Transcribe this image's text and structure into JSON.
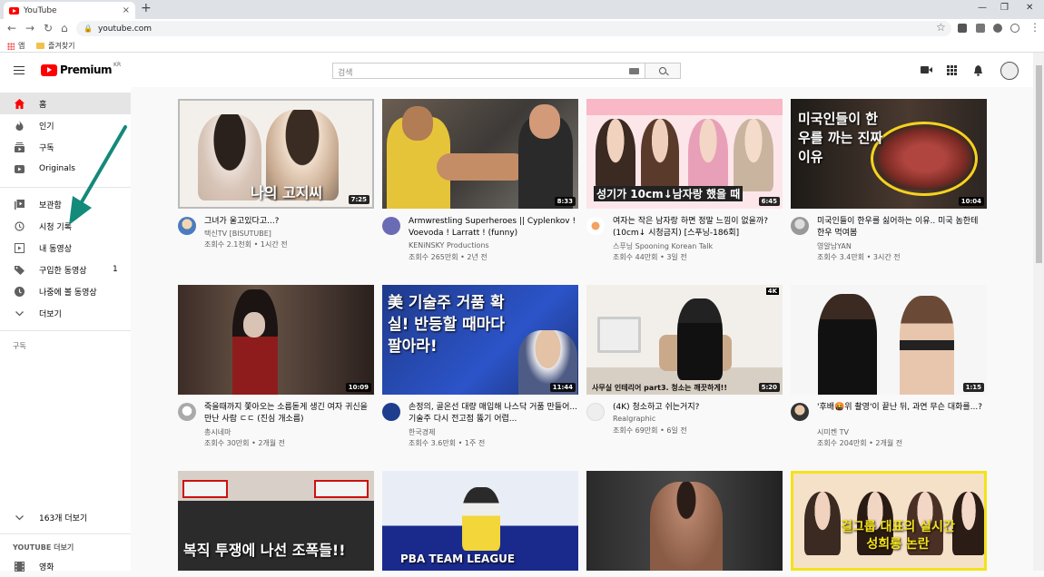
{
  "browser": {
    "tab_title": "YouTube",
    "tab_close": "×",
    "new_tab": "+",
    "url": "youtube.com",
    "bookmarks": [
      {
        "label": "앱"
      },
      {
        "label": "즐겨찾기"
      }
    ]
  },
  "masthead": {
    "logo_text": "Premium",
    "logo_region": "KR",
    "search_placeholder": "검색"
  },
  "sidebar": {
    "items": [
      {
        "label": "홈",
        "icon": "home-icon",
        "active": true
      },
      {
        "label": "인기",
        "icon": "trending-icon"
      },
      {
        "label": "구독",
        "icon": "subscriptions-icon"
      },
      {
        "label": "Originals",
        "icon": "originals-icon"
      },
      {
        "label": "보관함",
        "icon": "library-icon"
      },
      {
        "label": "시청 기록",
        "icon": "history-icon"
      },
      {
        "label": "내 동영상",
        "icon": "my-videos-icon"
      },
      {
        "label": "구입한 동영상",
        "icon": "purchases-icon",
        "count": "1"
      },
      {
        "label": "나중에 볼 동영상",
        "icon": "watch-later-icon"
      },
      {
        "label": "더보기",
        "icon": "chevron-down-icon"
      }
    ],
    "subscriptions_heading": "구독",
    "more_subs": "163개 더보기",
    "more_from_youtube": "YOUTUBE 더보기",
    "movies": "영화"
  },
  "videos": [
    {
      "title": "그녀가 울고있다고...?",
      "channel": "택신TV [BISUTUBE]",
      "stats": "조회수 2.1천회 • 1시간 전",
      "duration": "7:25",
      "caption": "나의 고지씨"
    },
    {
      "title": "Armwrestling Superheroes || Cyplenkov ! Voevoda ! Larratt ! (funny)",
      "channel": "KENiNSKY Productions",
      "stats": "조회수 265만회 • 2년 전",
      "duration": "8:33",
      "caption": ""
    },
    {
      "title": "여자는 작은 남자랑 하면 정말 느낌이 없을까?(10cm↓ 시청금지) [스푸닝-186회]",
      "channel": "스푸닝 Spooning Korean Talk",
      "stats": "조회수 44만회 • 3일 전",
      "duration": "6:45",
      "caption": "성기가 10cm↓남자랑 했을 때"
    },
    {
      "title": "미국인들이 한우를 싫어하는 이유.. 미국 놈한테 한우 먹여봄",
      "channel": "영알남YAN",
      "stats": "조회수 3.4만회 • 3시간 전",
      "duration": "10:04",
      "caption": "미국인들이 한우를 까는 진짜 이유"
    },
    {
      "title": "죽을때까지 쫓아오는 소름돋게 생긴 여자 귀신을 만난 사람 ㄷㄷ (진심 개소름)",
      "channel": "총시네마",
      "stats": "조회수 30만회 • 2개월 전",
      "duration": "10:09",
      "caption": ""
    },
    {
      "title": "손정의, 골온선 대량 매입해 나스닥 거품 만들어... 기술주 다시 전고점 뚫기 어렵...",
      "channel": "한국경제",
      "stats": "조회수 3.6만회 • 1주 전",
      "duration": "11:44",
      "caption": "美 기술주 거품 확실! 반등할 때마다 팔아라!"
    },
    {
      "title": "(4K) 청소하고 쉬는거지?",
      "channel": "Realgraphic",
      "stats": "조회수 69만회 • 6일 전",
      "duration": "5:20",
      "caption": "사무실 인테리어 part3. 청소는 깨끗하게!!"
    },
    {
      "title": "'후배🤬위 촬영'이 끝난 뒤, 과연 무슨 대화를...?",
      "channel": "시미켄 TV",
      "stats": "조회수 204만회 • 2개월 전",
      "duration": "1:15",
      "caption": ""
    },
    {
      "title": "",
      "channel": "",
      "stats": "",
      "duration": "",
      "caption": "복직 투쟁에 나선 조폭들!!"
    },
    {
      "title": "",
      "channel": "",
      "stats": "",
      "duration": "",
      "caption": "PBA TEAM LEAGUE"
    },
    {
      "title": "",
      "channel": "",
      "stats": "",
      "duration": "",
      "caption": ""
    },
    {
      "title": "",
      "channel": "",
      "stats": "",
      "duration": "",
      "caption": "걸그룹 대표의 실시간 성희롱 논란"
    }
  ],
  "colors": {
    "brand_red": "#ff0000",
    "annotation_arrow": "#138a7a"
  }
}
